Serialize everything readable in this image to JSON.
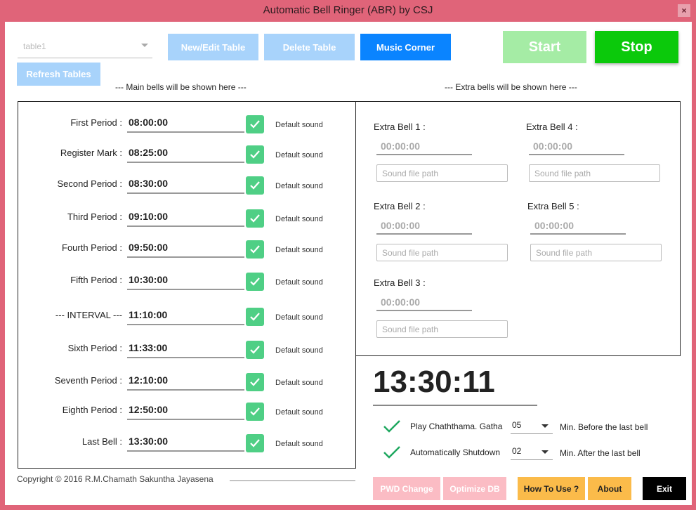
{
  "window": {
    "title": "Automatic Bell Ringer (ABR) by CSJ",
    "close_label": "×"
  },
  "table_select": {
    "value": "table1"
  },
  "toolbar": {
    "new_edit": "New/Edit Table",
    "delete": "Delete Table",
    "music": "Music Corner",
    "refresh": "Refresh Tables",
    "start": "Start",
    "stop": "Stop"
  },
  "sections": {
    "main_header": "--- Main bells will be shown here ---",
    "extra_header": "--- Extra bells will be shown here ---"
  },
  "main_bells": [
    {
      "label": "First Period :",
      "time": "08:00:00",
      "sound": "Default sound"
    },
    {
      "label": "Register Mark :",
      "time": "08:25:00",
      "sound": "Default sound"
    },
    {
      "label": "Second Period :",
      "time": "08:30:00",
      "sound": "Default sound"
    },
    {
      "label": "Third Period :",
      "time": "09:10:00",
      "sound": "Default sound"
    },
    {
      "label": "Fourth Period :",
      "time": "09:50:00",
      "sound": "Default sound"
    },
    {
      "label": "Fifth Period :",
      "time": "10:30:00",
      "sound": "Default sound"
    },
    {
      "label": "--- INTERVAL ---",
      "time": "11:10:00",
      "sound": "Default sound"
    },
    {
      "label": "Sixth Period :",
      "time": "11:33:00",
      "sound": "Default sound"
    },
    {
      "label": "Seventh Period :",
      "time": "12:10:00",
      "sound": "Default sound"
    },
    {
      "label": "Eighth Period :",
      "time": "12:50:00",
      "sound": "Default sound"
    },
    {
      "label": "Last Bell :",
      "time": "13:30:00",
      "sound": "Default sound"
    }
  ],
  "extra_bells": [
    {
      "label": "Extra Bell 1 :",
      "time": "00:00:00",
      "path_placeholder": "Sound file path"
    },
    {
      "label": "Extra Bell 2 :",
      "time": "00:00:00",
      "path_placeholder": "Sound file path"
    },
    {
      "label": "Extra Bell 3 :",
      "time": "00:00:00",
      "path_placeholder": "Sound file path"
    },
    {
      "label": "Extra Bell 4 :",
      "time": "00:00:00",
      "path_placeholder": "Sound file path"
    },
    {
      "label": "Extra Bell 5 :",
      "time": "00:00:00",
      "path_placeholder": "Sound file path"
    }
  ],
  "clock": {
    "time": "13:30:11"
  },
  "options": {
    "gatha": {
      "label": "Play Chaththama. Gatha",
      "value": "05",
      "suffix": "Min. Before the last bell",
      "checked": true
    },
    "shutdown": {
      "label": "Automatically Shutdown",
      "value": "02",
      "suffix": "Min. After the last bell",
      "checked": true
    }
  },
  "footer": {
    "copyright": "Copyright © 2016 R.M.Chamath Sakuntha Jayasena",
    "pwd_change": "PWD Change",
    "optimize_db": "Optimize DB",
    "how_to_use": "How To Use ?",
    "about": "About",
    "exit": "Exit"
  },
  "colors": {
    "frame": "#e06479",
    "light_blue": "#a8d3fb",
    "blue": "#0a84ff",
    "light_green": "#a5eca5",
    "green": "#0bc90b",
    "check_green": "#4fcf85",
    "light_pink": "#fbbcc4",
    "amber": "#fbbb4a",
    "black": "#000000"
  }
}
